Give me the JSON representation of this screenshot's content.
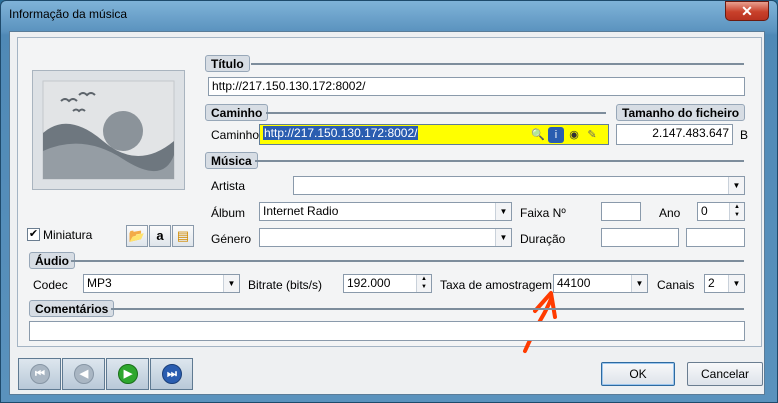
{
  "window": {
    "title": "Informação da música",
    "close_label": "✕"
  },
  "sections": {
    "titulo": "Título",
    "caminho": "Caminho",
    "tamanho": "Tamanho do ficheiro",
    "musica": "Música",
    "audio": "Áudio",
    "comentarios": "Comentários"
  },
  "fields": {
    "title_value": "http://217.150.130.172:8002/",
    "path_label": "Caminho",
    "path_value": "http://217.150.130.172:8002/",
    "size_value": "2.147.483.647",
    "size_unit": "B",
    "artist_label": "Artista",
    "artist_value": "",
    "album_label": "Álbum",
    "album_value": "Internet Radio",
    "genre_label": "Género",
    "genre_value": "",
    "track_label": "Faixa Nº",
    "track_value": "",
    "year_label": "Ano",
    "year_value": "0",
    "duration_label": "Duração",
    "duration_value": "",
    "codec_label": "Codec",
    "codec_value": "MP3",
    "bitrate_label": "Bitrate (bits/s)",
    "bitrate_value": "192.000",
    "samplerate_label": "Taxa de amostragem (k",
    "samplerate_value": "44100",
    "channels_label": "Canais",
    "channels_value": "2",
    "comments_value": ""
  },
  "thumbnail": {
    "label": "Miniatura",
    "checked": true
  },
  "buttons": {
    "ok": "OK",
    "cancel": "Cancelar"
  },
  "colors": {
    "path_highlight": "#ffff00",
    "path_text_bg": "#2a5db0",
    "annotation_arrow": "#ff3b00"
  },
  "icons": [
    "search-icon",
    "info-icon",
    "radio-icon",
    "tools-icon",
    "folder-image-icon",
    "amazon-icon",
    "file-image-icon",
    "first-icon",
    "previous-icon",
    "next-icon",
    "last-icon"
  ]
}
